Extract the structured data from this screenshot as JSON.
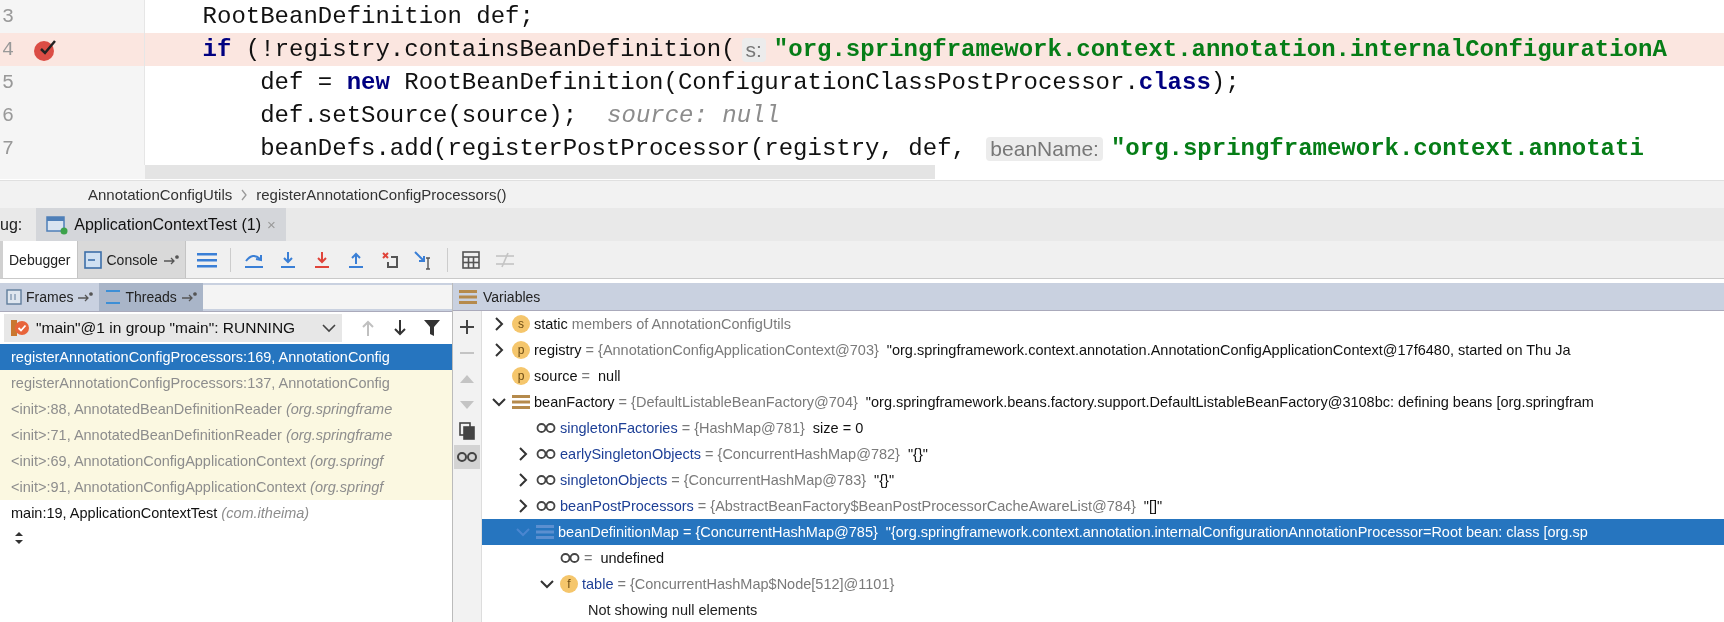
{
  "editor": {
    "lines": [
      {
        "number": "3",
        "breakpoint": false,
        "tokens": [
          {
            "kind": "code",
            "text": "    RootBeanDefinition def;"
          }
        ]
      },
      {
        "number": "4",
        "breakpoint": true,
        "tokens": [
          {
            "kind": "keyword",
            "text": "    if"
          },
          {
            "kind": "code",
            "text": " (!registry.containsBeanDefinition("
          },
          {
            "kind": "hint",
            "text": "s:"
          },
          {
            "kind": "string",
            "text": "\"org.springframework.context.annotation.internalConfigurationA"
          }
        ]
      },
      {
        "number": "5",
        "breakpoint": false,
        "tokens": [
          {
            "kind": "code",
            "text": "        def = "
          },
          {
            "kind": "keyword",
            "text": "new"
          },
          {
            "kind": "code",
            "text": " RootBeanDefinition(ConfigurationClassPostProcessor."
          },
          {
            "kind": "keyword",
            "text": "class"
          },
          {
            "kind": "code",
            "text": ");"
          }
        ]
      },
      {
        "number": "6",
        "breakpoint": false,
        "tokens": [
          {
            "kind": "code",
            "text": "        def.setSource(source);"
          },
          {
            "kind": "inline",
            "text": "source: null"
          }
        ]
      },
      {
        "number": "7",
        "breakpoint": false,
        "tokens": [
          {
            "kind": "code",
            "text": "        beanDefs.add(registerPostProcessor(registry, def, "
          },
          {
            "kind": "hint",
            "text": "beanName:"
          },
          {
            "kind": "string",
            "text": "\"org.springframework.context.annotati"
          }
        ]
      }
    ]
  },
  "breadcrumbs": [
    {
      "label": "AnnotationConfigUtils"
    },
    {
      "label": "registerAnnotationConfigProcessors()"
    }
  ],
  "debug_bar": {
    "label": "ug:",
    "tabs": [
      {
        "label": "ApplicationContextTest (1)",
        "close": "×",
        "selected": true
      }
    ]
  },
  "toolbar": {
    "tabs": [
      {
        "label": "Debugger",
        "kind": "plain",
        "selected": true
      },
      {
        "label": "Console",
        "kind": "console",
        "selected": false
      }
    ],
    "actions": [
      {
        "kind": "frames",
        "disabled": false
      },
      {
        "kind": "separator"
      },
      {
        "kind": "step-over",
        "disabled": false
      },
      {
        "kind": "step-into",
        "disabled": false
      },
      {
        "kind": "force-step-into",
        "disabled": false
      },
      {
        "kind": "step-out",
        "disabled": false
      },
      {
        "kind": "drop-frame",
        "disabled": false
      },
      {
        "kind": "run-to-cursor",
        "disabled": false
      },
      {
        "kind": "separator"
      },
      {
        "kind": "evaluate",
        "disabled": false
      },
      {
        "kind": "trace",
        "disabled": true
      }
    ]
  },
  "frames_panel": {
    "tabs": [
      {
        "label": "Frames",
        "selected": false
      },
      {
        "label": "Threads",
        "selected": true
      }
    ],
    "thread": {
      "value": "\"main\"@1 in group \"main\": RUNNING"
    },
    "nav": [
      {
        "kind": "up",
        "disabled": true
      },
      {
        "kind": "down",
        "disabled": false
      },
      {
        "kind": "filter",
        "disabled": false
      }
    ],
    "frames": [
      {
        "text": "registerAnnotationConfigProcessors:169, AnnotationConfig",
        "selected": true,
        "library": false
      },
      {
        "text": "registerAnnotationConfigProcessors:137, AnnotationConfig",
        "selected": false,
        "library": true
      },
      {
        "text": "<init>:88, AnnotatedBeanDefinitionReader",
        "location": "(org.springframe",
        "selected": false,
        "library": true
      },
      {
        "text": "<init>:71, AnnotatedBeanDefinitionReader",
        "location": "(org.springframe",
        "selected": false,
        "library": true
      },
      {
        "text": "<init>:69, AnnotationConfigApplicationContext",
        "location": "(org.springf",
        "selected": false,
        "library": true
      },
      {
        "text": "<init>:91, AnnotationConfigApplicationContext",
        "location": "(org.springf",
        "selected": false,
        "library": true
      },
      {
        "text": "main:19, ApplicationContextTest",
        "location": "(com.itheima)",
        "selected": false,
        "library": false
      }
    ]
  },
  "variables": {
    "title": "Variables",
    "side_actions": [
      {
        "kind": "add",
        "disabled": false
      },
      {
        "kind": "remove",
        "disabled": true
      },
      {
        "kind": "up",
        "disabled": true
      },
      {
        "kind": "down",
        "disabled": true
      },
      {
        "kind": "copy",
        "disabled": false
      },
      {
        "kind": "watch",
        "disabled": false,
        "selected": true
      }
    ],
    "items": [
      {
        "kind": "badge",
        "badge": "s",
        "expanded": false,
        "selected": false,
        "name": "static",
        "ref": "members of AnnotationConfigUtils"
      },
      {
        "kind": "badge",
        "badge": "p",
        "expanded": false,
        "selected": false,
        "name": "registry",
        "ref": "= {AnnotationConfigApplicationContext@703}",
        "value": "\"org.springframework.context.annotation.AnnotationConfigApplicationContext@17f6480, started on Thu Ja"
      },
      {
        "kind": "badge",
        "badge": "p",
        "selected": false,
        "name": "source",
        "ref": "=",
        "value": "null"
      },
      {
        "kind": "object",
        "expanded": true,
        "selected": false,
        "name": "beanFactory",
        "ref": "= {DefaultListableBeanFactory@704}",
        "value": "\"org.springframework.beans.factory.support.DefaultListableBeanFactory@3108bc: defining beans [org.springfram",
        "children": [
          {
            "kind": "watch",
            "selected": false,
            "name": "singletonFactories",
            "ref": "= {HashMap@781}",
            "value": "size = 0"
          },
          {
            "kind": "watch",
            "expanded": false,
            "selected": false,
            "name": "earlySingletonObjects",
            "ref": "= {ConcurrentHashMap@782}",
            "value": "\"{}\""
          },
          {
            "kind": "watch",
            "expanded": false,
            "selected": false,
            "name": "singletonObjects",
            "ref": "= {ConcurrentHashMap@783}",
            "value": "\"{}\""
          },
          {
            "kind": "watch",
            "expanded": false,
            "selected": false,
            "name": "beanPostProcessors",
            "ref": "= {AbstractBeanFactory$BeanPostProcessorCacheAwareList@784}",
            "value": "\"[]\""
          },
          {
            "kind": "object",
            "expanded": true,
            "selected": true,
            "name": "beanDefinitionMap",
            "ref": "= {ConcurrentHashMap@785}",
            "value": "\"{org.springframework.context.annotation.internalConfigurationAnnotationProcessor=Root bean: class [org.sp",
            "children": [
              {
                "kind": "watch",
                "selected": false,
                "ref": "=",
                "value": "undefined"
              },
              {
                "kind": "badge",
                "badge": "f",
                "expanded": true,
                "selected": false,
                "name": "table",
                "ref": "= {ConcurrentHashMap$Node[512]@1101}",
                "children": [
                  {
                    "kind": "message",
                    "selected": false,
                    "name": "Not showing null elements"
                  }
                ]
              }
            ]
          }
        ]
      }
    ]
  }
}
